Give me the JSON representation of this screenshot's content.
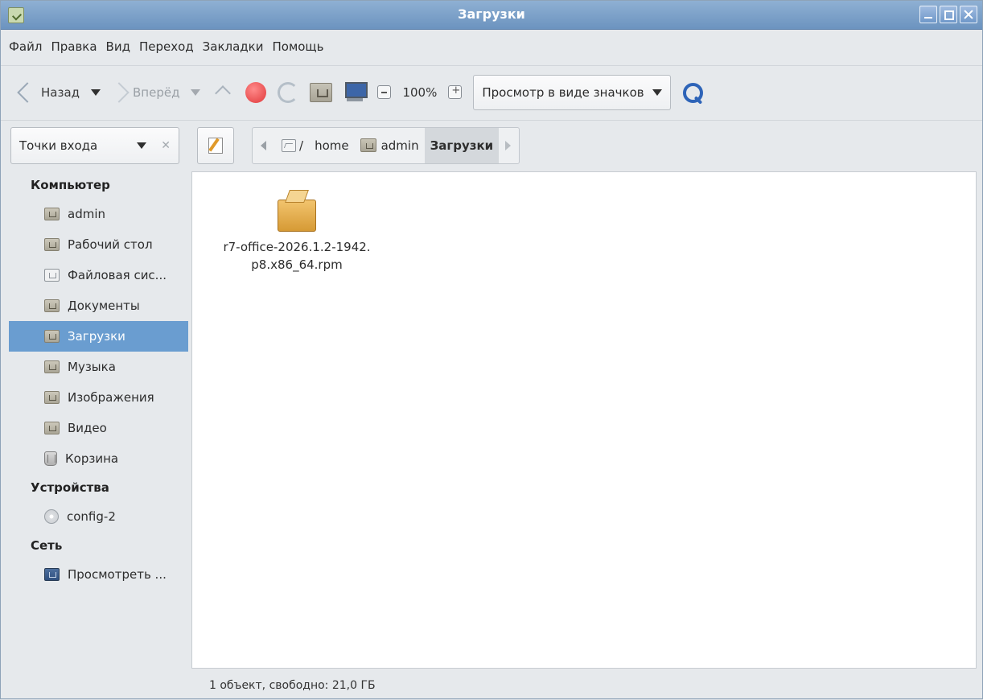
{
  "window": {
    "title": "Загрузки"
  },
  "menubar": {
    "items": [
      "Файл",
      "Правка",
      "Вид",
      "Переход",
      "Закладки",
      "Помощь"
    ]
  },
  "toolbar": {
    "back_label": "Назад",
    "forward_label": "Вперёд",
    "zoom_value": "100%",
    "view_mode": "Просмотр в виде значков"
  },
  "locationbar": {
    "places_label": "Точки входа",
    "path": [
      "/",
      "home",
      "admin",
      "Загрузки"
    ]
  },
  "sidebar": {
    "sections": [
      {
        "title": "Компьютер",
        "items": [
          "admin",
          "Рабочий стол",
          "Файловая сис...",
          "Документы",
          "Загрузки",
          "Музыка",
          "Изображения",
          "Видео",
          "Корзина"
        ]
      },
      {
        "title": "Устройства",
        "items": [
          "config-2"
        ]
      },
      {
        "title": "Сеть",
        "items": [
          "Просмотреть ..."
        ]
      }
    ],
    "active_item": "Загрузки"
  },
  "files": [
    {
      "name_line1": "r7-office-2026.1.2-1942.",
      "name_line2": "p8.x86_64.rpm",
      "icon": "package-icon"
    }
  ],
  "statusbar": {
    "text": "1 объект, свободно: 21,0 ГБ"
  },
  "colors": {
    "titlebar": "#7da1c9",
    "selection": "#6a9dd0",
    "stop": "#e0383a",
    "search": "#2e64b8"
  }
}
